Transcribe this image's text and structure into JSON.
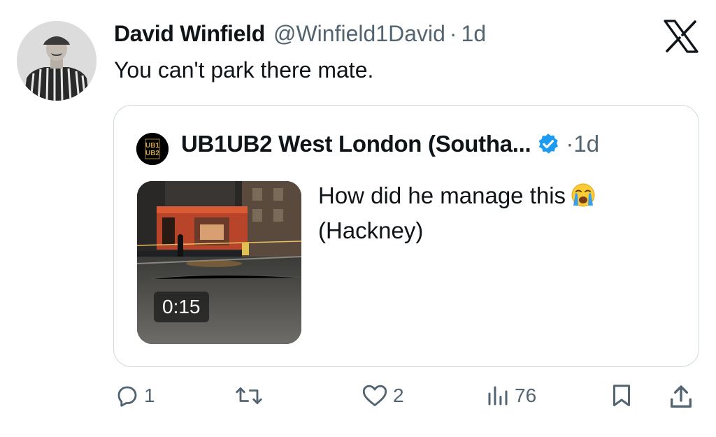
{
  "tweet": {
    "author_name": "David Winfield",
    "handle": "@Winfield1David",
    "separator": "·",
    "time": "1d",
    "text": "You can't park there mate."
  },
  "quoted_tweet": {
    "avatar_text_line1": "UB1",
    "avatar_text_line2": "UB2",
    "author_name": "UB1UB2 West London (Southa...",
    "separator": "·",
    "time": "1d",
    "text_line1": "How did he manage this",
    "text_line2": "(Hackney)",
    "emoji": "loudly-crying-face",
    "video_duration": "0:15"
  },
  "actions": {
    "replies": "1",
    "reposts": "",
    "likes": "2",
    "views": "76"
  },
  "colors": {
    "text": "#0f1419",
    "secondary": "#536471",
    "verified": "#1d9bf0",
    "border": "#cfd9de"
  }
}
